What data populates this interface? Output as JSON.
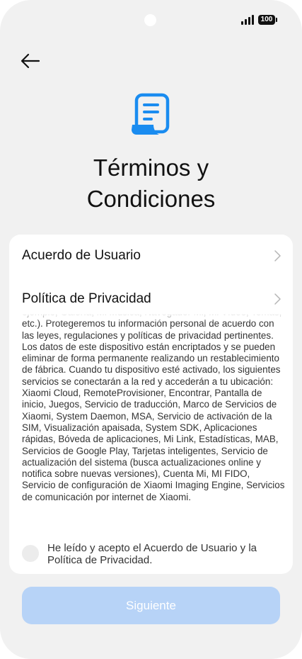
{
  "status_bar": {
    "battery": "100"
  },
  "page": {
    "title_line1": "Términos y",
    "title_line2": "Condiciones"
  },
  "links": [
    {
      "label": "Acuerdo de Usuario"
    },
    {
      "label": "Política de Privacidad"
    }
  ],
  "terms": {
    "body": "ejemplo, Galería, Mi Música, Navegador Mi, Mi Vídeo, Temas, etc.). Protegeremos tu información personal de acuerdo con las leyes, regulaciones y políticas de privacidad pertinentes. Los datos de este dispositivo están encriptados y se pueden eliminar de forma permanente realizando un restablecimiento de fábrica. Cuando tu dispositivo esté activado, los siguientes servicios se conectarán a la red y accederán a tu ubicación: Xiaomi Cloud, RemoteProvisioner, Encontrar, Pantalla de inicio, Juegos, Servicio de traducción, Marco de Servicios de Xiaomi, System Daemon, MSA, Servicio de activación de la SIM, Visualización apaisada, System SDK, Aplicaciones rápidas, Bóveda de aplicaciones, Mi Link, Estadísticas, MAB, Servicios de Google Play, Tarjetas inteligentes, Servicio de actualización del sistema (busca actualizaciones online y notifica sobre nuevas versiones), Cuenta Mi, MI FIDO, Servicio de configuración de Xiaomi Imaging Engine, Servicios de comunicación por internet de Xiaomi."
  },
  "consent": {
    "label": "He leído y acepto el Acuerdo de Usuario y la Política de Privacidad.",
    "checked": false
  },
  "actions": {
    "next_label": "Siguiente"
  },
  "colors": {
    "accent": "#1a8cf0",
    "button_disabled": "#b7d3f7"
  }
}
